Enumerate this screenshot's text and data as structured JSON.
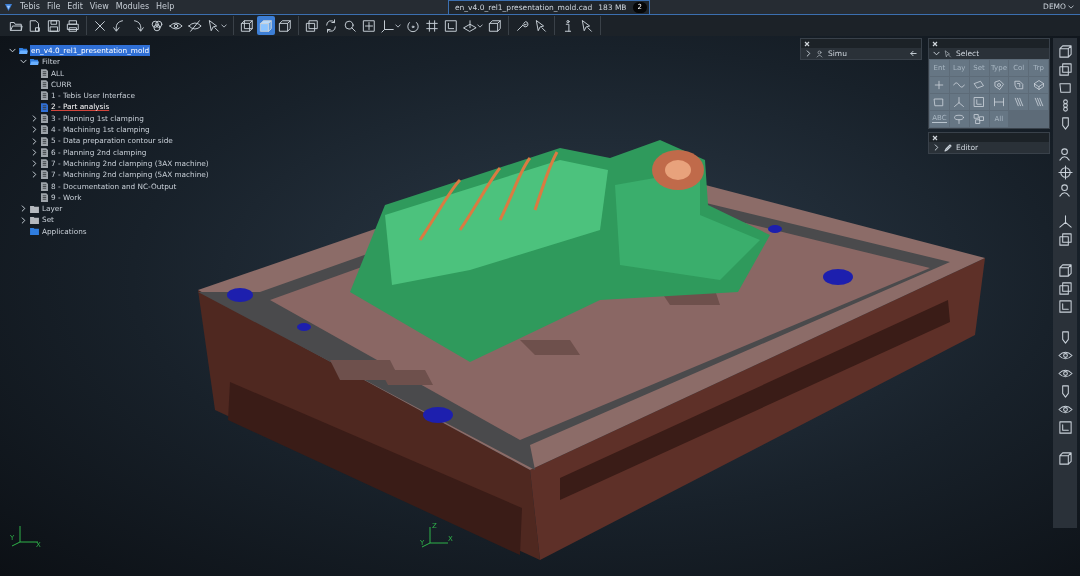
{
  "menu": {
    "items": [
      "Tebis",
      "File",
      "Edit",
      "View",
      "Modules",
      "Help"
    ]
  },
  "document_tab": {
    "title": "en_v4.0_rel1_presentation_mold.cad",
    "size": "183 MB",
    "count": "2"
  },
  "license": {
    "label": "DEMO"
  },
  "toolbar": [
    [
      {
        "kind": "open-folder",
        "selected": false
      },
      {
        "kind": "new-file",
        "selected": false
      },
      {
        "kind": "save",
        "selected": false
      },
      {
        "kind": "printer",
        "selected": false
      }
    ],
    [
      {
        "kind": "delete",
        "selected": false
      },
      {
        "kind": "undo",
        "selected": false
      },
      {
        "kind": "redo",
        "selected": false
      },
      {
        "kind": "circles",
        "selected": false
      },
      {
        "kind": "eye",
        "selected": false
      },
      {
        "kind": "eye-off",
        "selected": false
      },
      {
        "kind": "pointer",
        "selected": false,
        "menu": true
      }
    ],
    [
      {
        "kind": "cube-wire",
        "selected": false
      },
      {
        "kind": "cube-shaded",
        "selected": true
      },
      {
        "kind": "cube-plain",
        "selected": false
      }
    ],
    [
      {
        "kind": "layers",
        "selected": false
      },
      {
        "kind": "refresh",
        "selected": false
      },
      {
        "kind": "search",
        "selected": false
      },
      {
        "kind": "fit",
        "selected": false
      },
      {
        "kind": "axes",
        "selected": false,
        "menu": true
      },
      {
        "kind": "rotate",
        "selected": false
      },
      {
        "kind": "grid",
        "selected": false
      },
      {
        "kind": "frame",
        "selected": false
      },
      {
        "kind": "view-plane",
        "selected": false,
        "menu": true
      },
      {
        "kind": "cube-plain",
        "selected": false
      }
    ],
    [
      {
        "kind": "wrench",
        "selected": false
      },
      {
        "kind": "pointer",
        "selected": false
      }
    ],
    [
      {
        "kind": "info",
        "selected": false
      },
      {
        "kind": "pointer",
        "selected": false
      }
    ]
  ],
  "tree": [
    {
      "label": "en_v4.0_rel1_presentation_mold",
      "kind": "open-folder",
      "expandable": true,
      "expanded": true,
      "selected": true,
      "active": false,
      "children": [
        {
          "label": "Filter",
          "kind": "open-folder",
          "expandable": true,
          "expanded": true,
          "selected": false,
          "active": false,
          "children": [
            {
              "label": "ALL",
              "kind": "document",
              "expandable": false,
              "selected": false,
              "active": false
            },
            {
              "label": "CURR",
              "kind": "document",
              "expandable": false,
              "selected": false,
              "active": false
            },
            {
              "label": "1 - Tebis User Interface",
              "kind": "document",
              "expandable": false,
              "selected": false,
              "active": false
            },
            {
              "label": "2 - Part analysis",
              "kind": "document",
              "expandable": false,
              "selected": false,
              "active": true
            },
            {
              "label": "3 - Planning 1st clamping",
              "kind": "document",
              "expandable": true,
              "expanded": false,
              "selected": false,
              "active": false
            },
            {
              "label": "4 - Machining 1st clamping",
              "kind": "document",
              "expandable": true,
              "expanded": false,
              "selected": false,
              "active": false
            },
            {
              "label": "5 - Data preparation contour side",
              "kind": "document",
              "expandable": true,
              "expanded": false,
              "selected": false,
              "active": false
            },
            {
              "label": "6 - Planning 2nd clamping",
              "kind": "document",
              "expandable": true,
              "expanded": false,
              "selected": false,
              "active": false
            },
            {
              "label": "7 - Machining 2nd clamping (3AX machine)",
              "kind": "document",
              "expandable": true,
              "expanded": false,
              "selected": false,
              "active": false
            },
            {
              "label": "7 - Machining 2nd clamping (5AX machine)",
              "kind": "document",
              "expandable": true,
              "expanded": false,
              "selected": false,
              "active": false
            },
            {
              "label": "8 - Documentation and NC-Output",
              "kind": "document",
              "expandable": false,
              "selected": false,
              "active": false
            },
            {
              "label": "9 - Work",
              "kind": "document",
              "expandable": false,
              "selected": false,
              "active": false
            }
          ]
        },
        {
          "label": "Layer",
          "kind": "folder",
          "expandable": true,
          "expanded": false,
          "selected": false,
          "active": false
        },
        {
          "label": "Set",
          "kind": "folder",
          "expandable": true,
          "expanded": false,
          "selected": false,
          "active": false
        },
        {
          "label": "Applications",
          "kind": "app-folder",
          "expandable": false,
          "selected": false,
          "active": false
        }
      ]
    }
  ],
  "panels": {
    "simu": {
      "title": "Simu",
      "expanded": false
    },
    "select": {
      "title": "Select",
      "expanded": true,
      "tabs": [
        "Ent",
        "Lay",
        "Set",
        "Type",
        "Col",
        "Trp"
      ],
      "tools": [
        {
          "kind": "point"
        },
        {
          "kind": "curve"
        },
        {
          "kind": "surface"
        },
        {
          "kind": "solid"
        },
        {
          "kind": "face-group"
        },
        {
          "kind": "body"
        },
        {
          "kind": "plane"
        },
        {
          "kind": "branch"
        },
        {
          "kind": "frame"
        },
        {
          "kind": "dimension"
        },
        {
          "kind": "hatch"
        },
        {
          "kind": "hatch"
        },
        {
          "kind": "text-line",
          "label": "ABC"
        },
        {
          "kind": "lasso"
        },
        {
          "kind": "cluster"
        },
        {
          "kind": "text",
          "label": "All"
        }
      ]
    },
    "editor": {
      "title": "Editor",
      "expanded": false
    }
  },
  "side_toolbar": [
    [
      {
        "kind": "cube-plain"
      },
      {
        "kind": "layers"
      },
      {
        "kind": "plane"
      },
      {
        "kind": "chain"
      },
      {
        "kind": "tool"
      }
    ],
    [
      {
        "kind": "person"
      },
      {
        "kind": "target"
      },
      {
        "kind": "person"
      }
    ],
    [
      {
        "kind": "branch"
      },
      {
        "kind": "layers"
      }
    ],
    [
      {
        "kind": "cube-plain"
      },
      {
        "kind": "layers"
      },
      {
        "kind": "frame"
      }
    ],
    [
      {
        "kind": "tool"
      },
      {
        "kind": "eye"
      },
      {
        "kind": "eye"
      },
      {
        "kind": "tool"
      },
      {
        "kind": "eye"
      },
      {
        "kind": "frame"
      }
    ],
    [
      {
        "kind": "cube-plain"
      }
    ]
  ],
  "triads": [
    {
      "labels": [
        "Y",
        "X"
      ]
    },
    {
      "labels": [
        "Z",
        "Y",
        "X"
      ]
    }
  ]
}
